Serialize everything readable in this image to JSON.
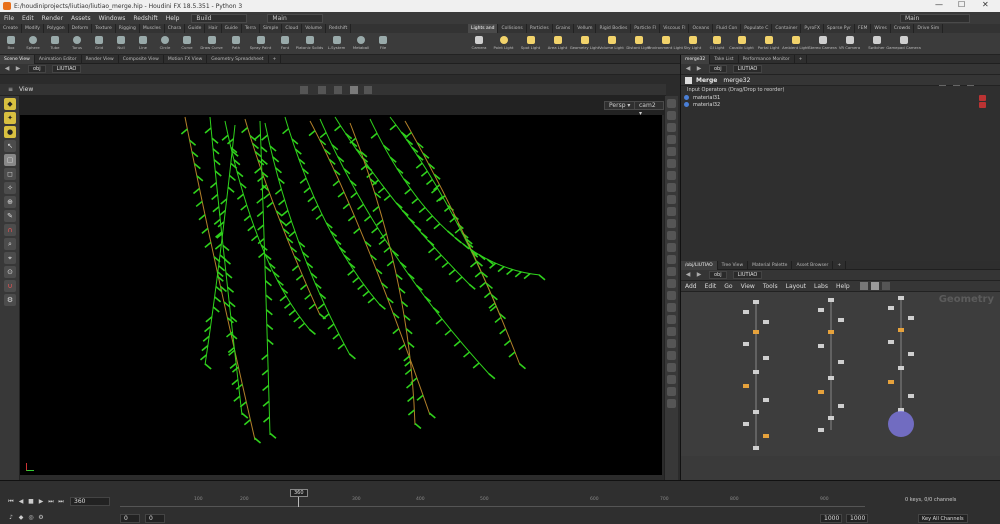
{
  "title_bar": {
    "title": "E:/houdiniprojects/liutiao/liutiao_merge.hip - Houdini FX 18.5.351 - Python 3"
  },
  "menu_bar": {
    "items": [
      "File",
      "Edit",
      "Render",
      "Assets",
      "Windows",
      "Redshift",
      "Help"
    ],
    "desktop_select": "Build",
    "main_select": "Main",
    "right_select": "Main"
  },
  "shelf_tabs_left": [
    "Create",
    "Modify",
    "Polygon",
    "Deform",
    "Texture",
    "Rigging",
    "Muscles",
    "Chara",
    "Guide",
    "Hair",
    "Guide",
    "Terra",
    "Simple",
    "Cloud",
    "Volume",
    "Redshift"
  ],
  "shelf_tabs_right": [
    "Lights and",
    "Collisions",
    "Particles",
    "Grains",
    "Vellum",
    "Rigid Bodies",
    "Particle Fl",
    "Viscous Fl",
    "Oceans",
    "Fluid Con",
    "Populate C",
    "Container",
    "PyroFX",
    "Sparse Pyr",
    "FEM",
    "Wires",
    "Crowds",
    "Drive Sim"
  ],
  "shelf_tools_left": [
    "Box",
    "Sphere",
    "Tube",
    "Torus",
    "Grid",
    "Null",
    "Line",
    "Circle",
    "Curve",
    "Draw Curve",
    "Path",
    "Spray Paint",
    "Font",
    "Platonic Solids",
    "L-System",
    "Metaball",
    "File"
  ],
  "shelf_tools_right": [
    "Camera",
    "Point Light",
    "Spot Light",
    "Area Light",
    "Geometry Light",
    "Volume Light",
    "Distant Light",
    "Environment Light",
    "Sky Light",
    "GI Light",
    "Caustic Light",
    "Portal Light",
    "Ambient Light",
    "Stereo Camera",
    "VR Camera",
    "Switcher",
    "Gamepad Camera"
  ],
  "left_pane": {
    "tabs": [
      "Scene View",
      "Animation Editor",
      "Render View",
      "Composite View",
      "Motion FX View",
      "Geometry Spreadsheet"
    ],
    "path_root": "obj",
    "path_node": "LIUTIAO",
    "view_label": "View",
    "persp_menu": "Persp ▾",
    "cam_menu": "cam2 ▾"
  },
  "right_top": {
    "tabs": [
      "merge32",
      "Take List",
      "Performance Monitor"
    ],
    "path_root": "obj",
    "path_node": "LIUTIAO",
    "node_type": "Merge",
    "node_name": "merge32",
    "inputs_label": "Input Operators (Drag/Drop to reorder)",
    "inputs": [
      "material31",
      "material32"
    ]
  },
  "right_bottom": {
    "tabs": [
      "/obj/LIUTIAO",
      "Tree View",
      "Material Palette",
      "Asset Browser"
    ],
    "path_root": "obj",
    "path_node": "LIUTIAO",
    "menu": [
      "Add",
      "Edit",
      "Go",
      "View",
      "Tools",
      "Layout",
      "Labs",
      "Help"
    ],
    "context_label": "Geometry"
  },
  "timeline": {
    "current_frame": "360",
    "marker_frame": "360",
    "start_frame": "0",
    "start_frame2": "0",
    "end_frame": "1000",
    "end_frame2": "1000",
    "ticks": [
      "100",
      "200",
      "300",
      "400",
      "500",
      "600",
      "700",
      "800",
      "900"
    ],
    "keys_info": "0 keys, 0/0 channels",
    "key_all": "Key All Channels"
  },
  "colors": {
    "viewport_bg": "#000000",
    "leaf_green": "#2fd11c",
    "branch_orange": "#b3802a",
    "selected_node": "#7a74d8"
  }
}
